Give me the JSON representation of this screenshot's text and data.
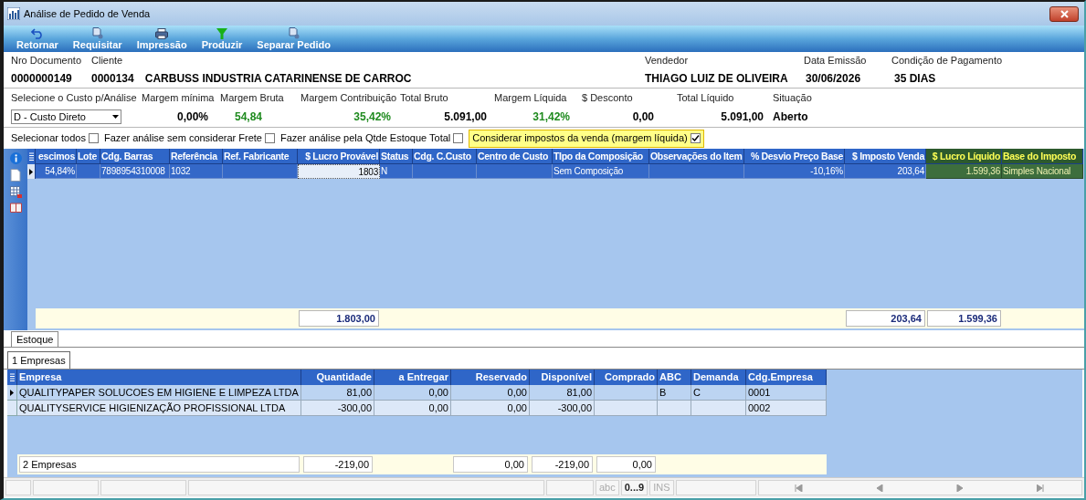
{
  "window": {
    "title": "Análise de Pedido de Venda"
  },
  "toolbar": [
    {
      "label": "Retornar",
      "kind": "undo"
    },
    {
      "label": "Requisitar",
      "kind": "document"
    },
    {
      "label": "Impressão",
      "kind": "printer"
    },
    {
      "label": "Produzir",
      "kind": "filter"
    },
    {
      "label": "Separar Pedido",
      "kind": "document"
    }
  ],
  "header": {
    "document": {
      "label": "Nro Documento",
      "value": "0000000149"
    },
    "client": {
      "label": "Cliente",
      "code": "0000134",
      "name": "CARBUSS INDUSTRIA CATARINENSE DE CARROC"
    },
    "seller": {
      "label": "Vendedor",
      "value": "THIAGO LUIZ DE OLIVEIRA"
    },
    "date": {
      "label": "Data Emissão",
      "value": "30/06/2026"
    },
    "payment": {
      "label": "Condição de Pagamento",
      "value": "35 DIAS"
    }
  },
  "cost_select": {
    "label": "Selecione o Custo p/Análise",
    "value": "D - Custo Direto"
  },
  "metrics": [
    {
      "label": "Margem mínima",
      "value": "0,00%",
      "color": "#000000"
    },
    {
      "label": "Margem Bruta",
      "value": "54,84",
      "color": "#1e8a1e"
    },
    {
      "label": "Margem Contribuição",
      "value": "35,42%",
      "color": "#1e8a1e"
    },
    {
      "label": "Total Bruto",
      "value": "5.091,00",
      "color": "#000000"
    },
    {
      "label": "Margem Líquida",
      "value": "31,42%",
      "color": "#1e8a1e"
    },
    {
      "label": "$ Desconto",
      "value": "0,00",
      "color": "#000000"
    },
    {
      "label": "Total Líquido",
      "value": "5.091,00",
      "color": "#000000"
    },
    {
      "label": "Situação",
      "value": "Aberto",
      "color": "#000000"
    }
  ],
  "options": [
    {
      "label": "Selecionar todos",
      "checked": false,
      "highlighted": false
    },
    {
      "label": "Fazer análise sem considerar Frete",
      "checked": false,
      "highlighted": false
    },
    {
      "label": "Fazer análise pela Qtde Estoque Total",
      "checked": false,
      "highlighted": false
    },
    {
      "label": "Considerar impostos da venda (margem líquida)",
      "checked": true,
      "highlighted": true
    }
  ],
  "items_grid": {
    "columns": [
      {
        "label": "escimos",
        "numeric": true,
        "accent": false,
        "focused": false
      },
      {
        "label": "Lote",
        "numeric": false,
        "accent": false,
        "focused": false
      },
      {
        "label": "Cdg. Barras",
        "numeric": false,
        "accent": false,
        "focused": false
      },
      {
        "label": "Referência",
        "numeric": false,
        "accent": false,
        "focused": false
      },
      {
        "label": "Ref. Fabricante",
        "numeric": false,
        "accent": false,
        "focused": false
      },
      {
        "label": "$ Lucro Provável",
        "numeric": true,
        "accent": false,
        "focused": true,
        "total": "1.803,00"
      },
      {
        "label": "Status",
        "numeric": false,
        "accent": false,
        "focused": false
      },
      {
        "label": "Cdg. C.Custo",
        "numeric": false,
        "accent": false,
        "focused": false
      },
      {
        "label": "Centro de Custo",
        "numeric": false,
        "accent": false,
        "focused": false
      },
      {
        "label": "TIpo da Composição",
        "numeric": false,
        "accent": false,
        "focused": false
      },
      {
        "label": "Observações do Item",
        "numeric": false,
        "accent": false,
        "focused": false
      },
      {
        "label": "% Desvio Preço Base",
        "numeric": true,
        "accent": false,
        "focused": false
      },
      {
        "label": "$ Imposto Venda",
        "numeric": true,
        "accent": false,
        "focused": false,
        "total": "203,64"
      },
      {
        "label": "$ Lucro Líquido",
        "numeric": true,
        "accent": true,
        "focused": false,
        "total": "1.599,36"
      },
      {
        "label": "Base do Imposto",
        "numeric": false,
        "accent": true,
        "focused": false
      }
    ],
    "rows": [
      {
        "selected": true,
        "acrescimos": "54,84%",
        "barcode": "7898954310008",
        "reference": "1032",
        "lucro_provavel": "1803",
        "status": "N",
        "composition": "Sem Composição",
        "desvio": "-10,16%",
        "imposto": "203,64",
        "lucro_liquido": "1.599,36",
        "base_imposto": "Simples Nacional"
      }
    ]
  },
  "tabs": [
    {
      "label": "Estoque",
      "selected": true
    }
  ],
  "subtabs": [
    {
      "label": "1 Empresas",
      "selected": true
    }
  ],
  "stock_grid": {
    "columns": [
      {
        "label": "Empresa",
        "numeric": false,
        "total": "2 Empresas"
      },
      {
        "label": "Quantidade",
        "numeric": true,
        "total": "-219,00"
      },
      {
        "label": "a Entregar",
        "numeric": true
      },
      {
        "label": "Reservado",
        "numeric": true,
        "total": "0,00"
      },
      {
        "label": "Disponível",
        "numeric": true,
        "total": "-219,00"
      },
      {
        "label": "Comprado",
        "numeric": true,
        "total": "0,00"
      },
      {
        "label": "ABC",
        "numeric": false
      },
      {
        "label": "Demanda",
        "numeric": false
      },
      {
        "label": "Cdg.Empresa",
        "numeric": false
      }
    ],
    "rows": [
      {
        "selected": true,
        "company": "QUALITYPAPER SOLUCOES EM HIGIENE E LIMPEZA LTDA",
        "quantity": "81,00",
        "to_deliver": "0,00",
        "reserved": "0,00",
        "available": "81,00",
        "abc": "B",
        "demand": "C",
        "company_code": "0001"
      },
      {
        "selected": false,
        "company": "QUALITYSERVICE HIGIENIZAÇÃO PROFISSIONAL LTDA",
        "quantity": "-300,00",
        "to_deliver": "0,00",
        "reserved": "0,00",
        "available": "-300,00",
        "company_code": "0002"
      }
    ]
  },
  "status_bar": {
    "indicators": [
      {
        "label": "abc",
        "on": false
      },
      {
        "label": "0...9",
        "on": true
      },
      {
        "label": "INS",
        "on": false
      }
    ]
  }
}
